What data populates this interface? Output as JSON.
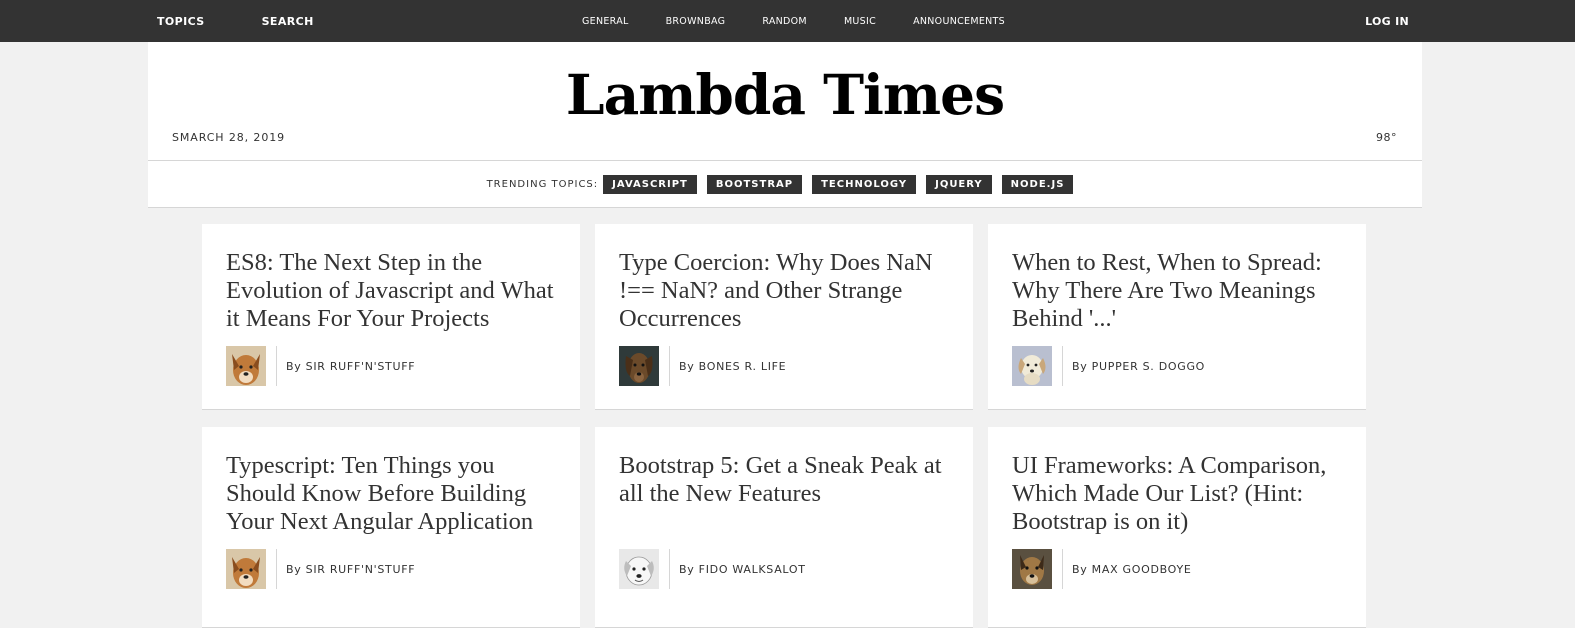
{
  "topnav": {
    "topics": "TOPICS",
    "search": "SEARCH",
    "categories": [
      "GENERAL",
      "BROWNBAG",
      "RANDOM",
      "MUSIC",
      "ANNOUNCEMENTS"
    ],
    "login": "LOG IN"
  },
  "header": {
    "title": "Lambda Times",
    "date": "SMARCH 28, 2019",
    "temperature": "98°"
  },
  "trending": {
    "label": "TRENDING TOPICS:",
    "tags": [
      "JAVASCRIPT",
      "BOOTSTRAP",
      "TECHNOLOGY",
      "JQUERY",
      "NODE.JS"
    ]
  },
  "articles": [
    {
      "headline": "ES8: The Next Step in the Evolution of Javascript and What it Means For Your Projects",
      "by": "By",
      "author": "SIR RUFF'N'STUFF",
      "avatar": "dog-avatar-tan"
    },
    {
      "headline": "Type Coercion: Why Does NaN !== NaN? and Other Strange Occurrences",
      "by": "By",
      "author": "BONES R. LIFE",
      "avatar": "dog-avatar-dark"
    },
    {
      "headline": "When to Rest, When to Spread: Why There Are Two Meanings Behind '...'",
      "by": "By",
      "author": "PUPPER S. DOGGO",
      "avatar": "dog-avatar-light"
    },
    {
      "headline": "Typescript: Ten Things you Should Know Before Building Your Next Angular Application",
      "by": "By",
      "author": "SIR RUFF'N'STUFF",
      "avatar": "dog-avatar-tan"
    },
    {
      "headline": "Bootstrap 5: Get a Sneak Peak at all the New Features",
      "by": "By",
      "author": "FIDO WALKSALOT",
      "avatar": "dog-avatar-white"
    },
    {
      "headline": "UI Frameworks: A Comparison, Which Made Our List? (Hint: Bootstrap is on it)",
      "by": "By",
      "author": "MAX GOODBOYE",
      "avatar": "dog-avatar-brown"
    }
  ],
  "colors": {
    "navbar": "#333333",
    "background": "#f1f1f1",
    "card": "#ffffff"
  }
}
